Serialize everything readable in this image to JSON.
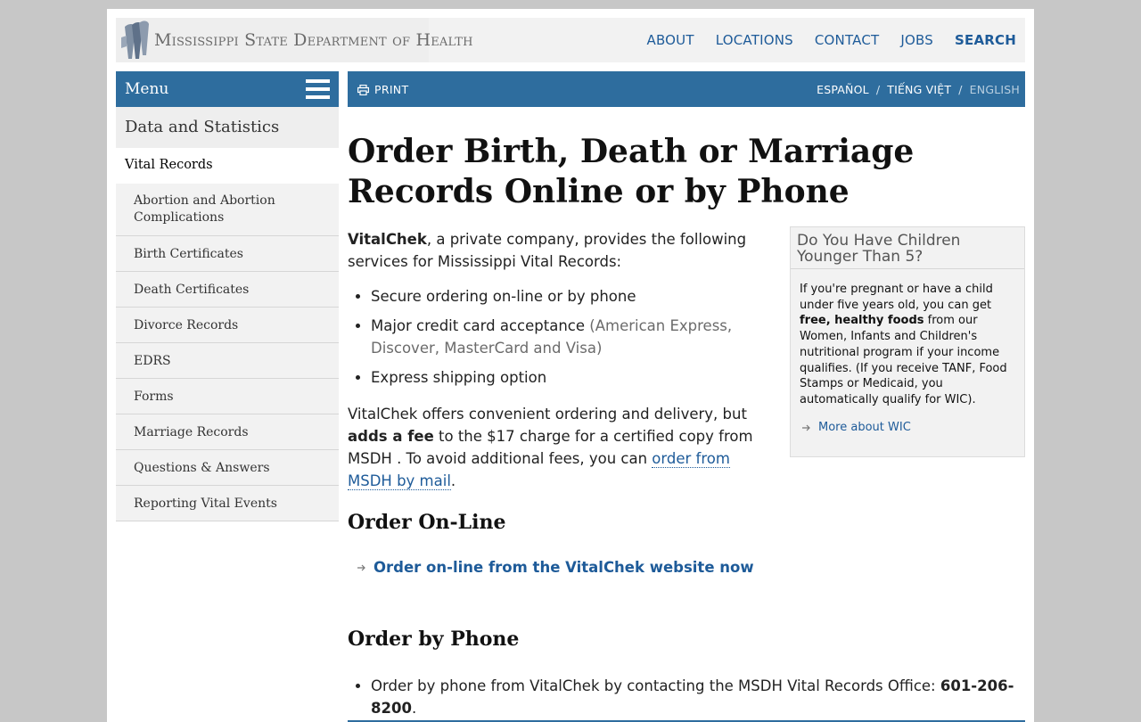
{
  "header": {
    "logo_text": "Mississippi State Department of Health",
    "nav": [
      "ABOUT",
      "LOCATIONS",
      "CONTACT",
      "JOBS",
      "SEARCH"
    ]
  },
  "sidebar": {
    "menu_label": "Menu",
    "section_title": "Data and Statistics",
    "current": "Vital Records",
    "items": [
      "Abortion and Abortion Complications",
      "Birth Certificates",
      "Death Certificates",
      "Divorce Records",
      "EDRS",
      "Forms",
      "Marriage Records",
      "Questions & Answers",
      "Reporting Vital Events"
    ]
  },
  "toolbar": {
    "print": "PRINT",
    "languages": [
      "ESPAÑOL",
      "TIẾNG VIỆT",
      "ENGLISH"
    ],
    "active_language": "ENGLISH"
  },
  "main": {
    "title": "Order Birth, Death or Marriage Records Online or by Phone",
    "intro_bold": "VitalChek",
    "intro_rest": ", a private company, provides the following services for Mississippi Vital Records:",
    "services": [
      {
        "text": "Secure ordering on-line or by phone",
        "note": ""
      },
      {
        "text": "Major credit card acceptance",
        "note": "(American Express, Discover, MasterCard and Visa)"
      },
      {
        "text": "Express shipping option",
        "note": ""
      }
    ],
    "fee_part1": "VitalChek offers convenient ordering and delivery, but ",
    "fee_bold": "adds a fee",
    "fee_part2": " to the $17 charge for a certified copy from MSDH . To avoid additional fees, you can ",
    "fee_link": "order from MSDH by mail",
    "fee_end": ".",
    "online_heading": "Order On-Line",
    "online_link": "Order on-line from the VitalChek website now",
    "phone_heading": "Order by Phone",
    "phone_text": "Order by phone from VitalChek by contacting the MSDH Vital Records Office: ",
    "phone_number": "601-206-8200",
    "phone_end": "."
  },
  "aside": {
    "title": "Do You Have Children Younger Than 5?",
    "text_part1": "If you're pregnant or have a child under five years old, you can get ",
    "text_bold": "free, healthy foods",
    "text_part2": " from our Women, Infants and Children's nutritional program if your income qualifies. (If you receive TANF, Food Stamps or Medicaid, you automatically qualify for WIC).",
    "link": "More about WIC"
  },
  "colors": {
    "brand_blue": "#2e6d9e",
    "link_blue": "#1e5b99",
    "background_gray": "#c7c7c7"
  }
}
